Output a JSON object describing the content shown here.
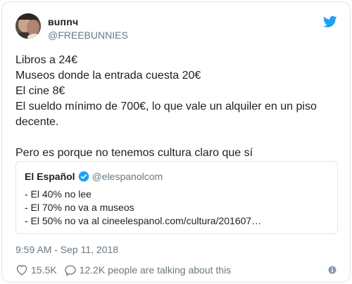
{
  "author": {
    "display_name": "ʙuпnч",
    "handle": "@FREEBUNNIES",
    "avatar_icon": "user-avatar"
  },
  "platform_icon": "twitter-bird-icon",
  "tweet": {
    "lines": [
      "Libros a 24€",
      "Museos donde la entrada cuesta 20€",
      "El cine 8€",
      "El sueldo mínimo de 700€, lo que vale un alquiler en un piso decente.",
      "",
      "Pero es porque no tenemos cultura claro que sí"
    ]
  },
  "quoted_tweet": {
    "name": "El Español",
    "verified": true,
    "handle": "@elespanolcom",
    "lines": [
      "- El 40% no lee",
      "- El 70% no va a museos",
      "- El 50% no va al cineelespanol.com/cultura/201607…"
    ]
  },
  "timestamp": "9:59 AM - Sep 11, 2018",
  "actions": {
    "likes": "15.5K",
    "talking": "12.2K people are talking about this"
  },
  "colors": {
    "twitter_blue": "#1da1f2",
    "text": "#1c2022",
    "muted": "#697882",
    "border": "#e1e8ed"
  }
}
